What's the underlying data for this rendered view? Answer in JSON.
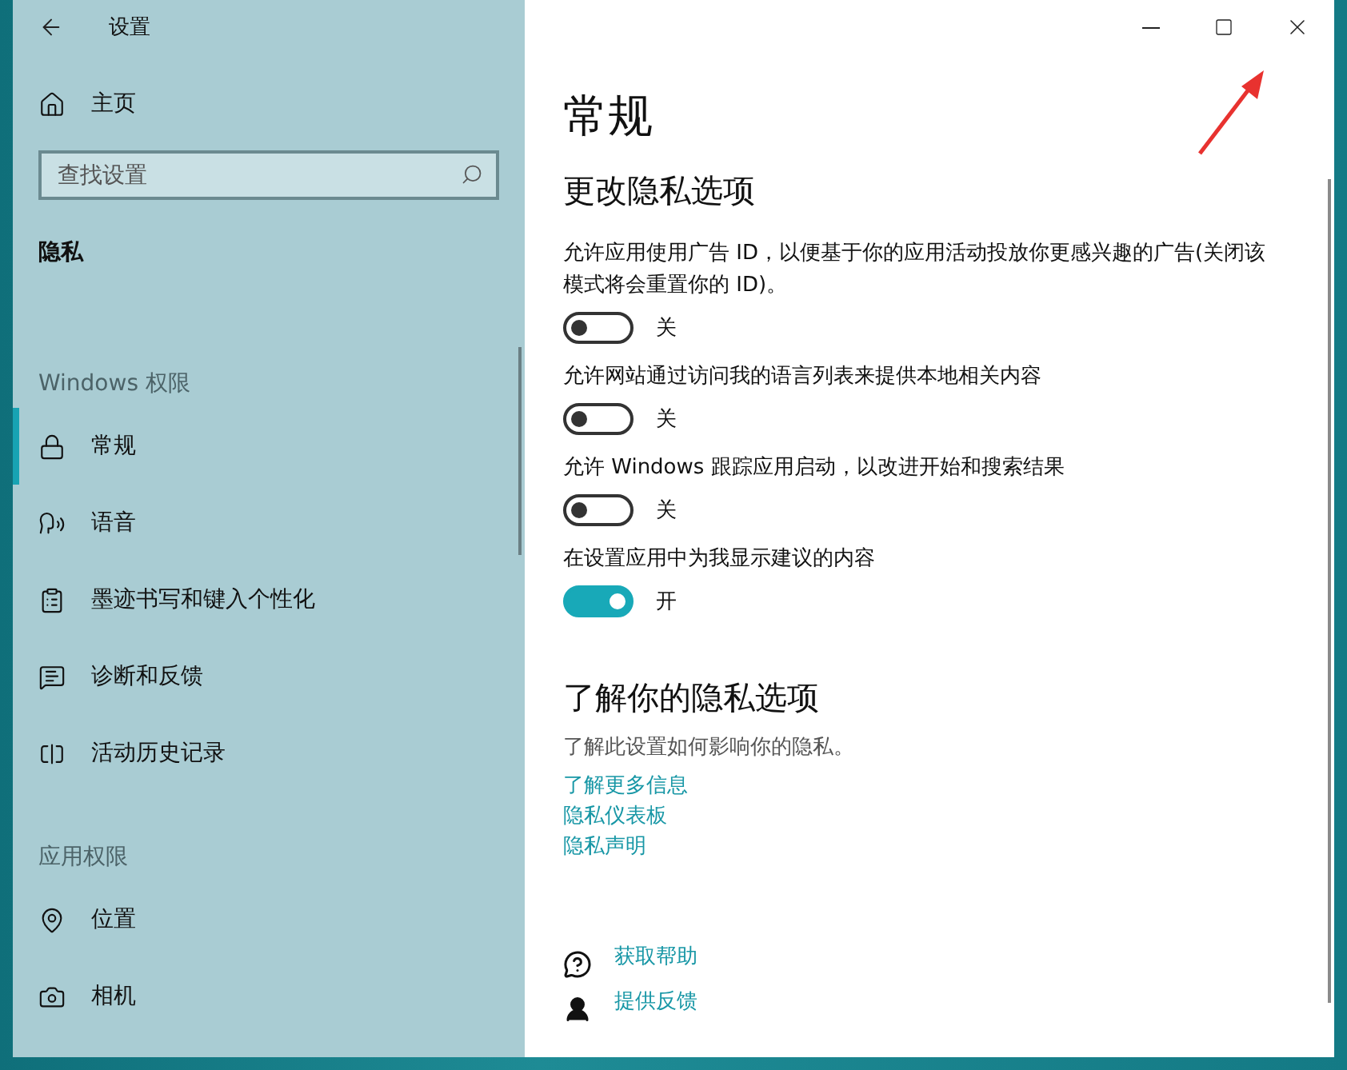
{
  "window": {
    "title": "设置"
  },
  "sidebar": {
    "home": "主页",
    "search": {
      "placeholder": "查找设置"
    },
    "section": "隐私",
    "groups": [
      {
        "heading": "Windows 权限",
        "items": [
          {
            "label": "常规",
            "kind": "lock",
            "selected": true
          },
          {
            "label": "语音",
            "kind": "speech",
            "selected": false
          },
          {
            "label": "墨迹书写和键入个性化",
            "kind": "clipboard",
            "selected": false
          },
          {
            "label": "诊断和反馈",
            "kind": "feedback",
            "selected": false
          },
          {
            "label": "活动历史记录",
            "kind": "activity",
            "selected": false
          }
        ]
      },
      {
        "heading": "应用权限",
        "items": [
          {
            "label": "位置",
            "kind": "location",
            "selected": false
          },
          {
            "label": "相机",
            "kind": "camera",
            "selected": false
          }
        ]
      }
    ]
  },
  "page": {
    "title": "常规",
    "section_title": "更改隐私选项",
    "options": [
      {
        "text": "允许应用使用广告 ID，以便基于你的应用活动投放你更感兴趣的广告(关闭该模式将会重置你的 ID)。",
        "on": false,
        "state_label": "关"
      },
      {
        "text": "允许网站通过访问我的语言列表来提供本地相关内容",
        "on": false,
        "state_label": "关"
      },
      {
        "text": "允许 Windows 跟踪应用启动，以改进开始和搜索结果",
        "on": false,
        "state_label": "关"
      },
      {
        "text": "在设置应用中为我显示建议的内容",
        "on": true,
        "state_label": "开"
      }
    ],
    "learn": {
      "title": "了解你的隐私选项",
      "text": "了解此设置如何影响你的隐私。",
      "links": [
        "了解更多信息",
        "隐私仪表板",
        "隐私声明"
      ]
    },
    "help": [
      {
        "label": "获取帮助",
        "kind": "help"
      },
      {
        "label": "提供反馈",
        "kind": "feedback"
      }
    ]
  }
}
